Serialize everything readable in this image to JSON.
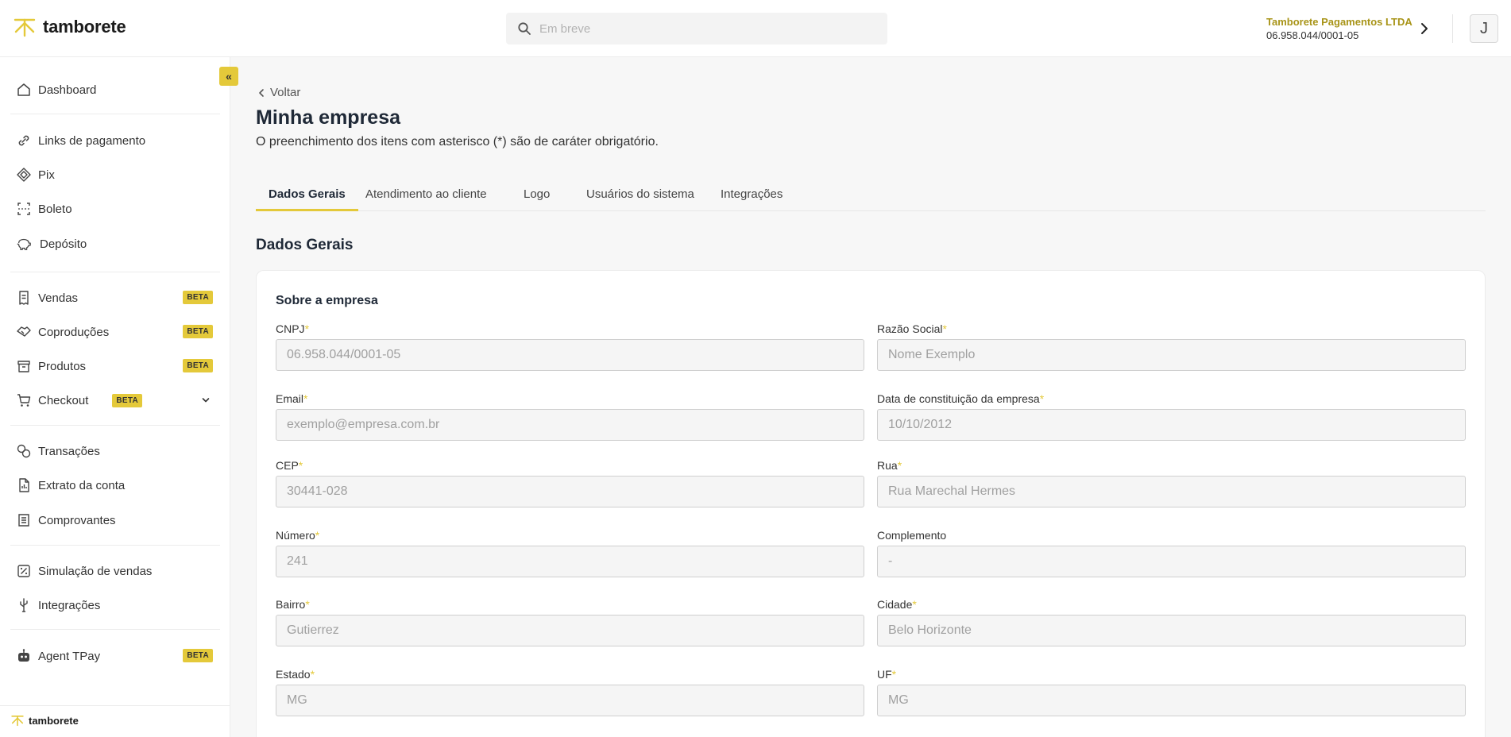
{
  "brand": {
    "name": "tamborete",
    "accent": "#e4c93a",
    "accent_dark": "#a89418"
  },
  "header": {
    "search_placeholder": "Em breve",
    "company_name": "Tamborete Pagamentos LTDA",
    "company_cnpj": "06.958.044/0001-05",
    "avatar_initial": "J"
  },
  "sidebar": {
    "collapse_label": "«",
    "items": [
      {
        "label": "Dashboard",
        "icon": "home-icon"
      },
      {
        "label": "Links de pagamento",
        "icon": "link-icon"
      },
      {
        "label": "Pix",
        "icon": "pix-icon"
      },
      {
        "label": "Boleto",
        "icon": "barcode-scan-icon"
      },
      {
        "label": "Depósito",
        "icon": "piggy-bank-icon"
      },
      {
        "label": "Vendas",
        "icon": "receipt-icon",
        "badge": "BETA"
      },
      {
        "label": "Coproduções",
        "icon": "handshake-icon",
        "badge": "BETA"
      },
      {
        "label": "Produtos",
        "icon": "box-icon",
        "badge": "BETA"
      },
      {
        "label": "Checkout",
        "icon": "cart-icon",
        "badge": "BETA"
      },
      {
        "label": "Transações",
        "icon": "transactions-icon"
      },
      {
        "label": "Extrato da conta",
        "icon": "statement-icon"
      },
      {
        "label": "Comprovantes",
        "icon": "list-icon"
      },
      {
        "label": "Simulação de vendas",
        "icon": "percent-icon"
      },
      {
        "label": "Integrações",
        "icon": "usb-icon"
      },
      {
        "label": "Agent TPay",
        "icon": "robot-icon",
        "badge": "BETA"
      }
    ],
    "footer_brand": "tamborete"
  },
  "page": {
    "back_label": "Voltar",
    "title": "Minha empresa",
    "subtitle": "O preenchimento dos itens com asterisco (*) são de caráter obrigatório.",
    "tabs": [
      "Dados Gerais",
      "Atendimento ao cliente",
      "Logo",
      "Usuários do sistema",
      "Integrações"
    ],
    "active_tab": "Dados Gerais",
    "section_title": "Dados Gerais",
    "card_title": "Sobre a empresa"
  },
  "form": {
    "cnpj": {
      "label": "CNPJ",
      "required": "*",
      "placeholder": "06.958.044/0001-05"
    },
    "razao_social": {
      "label": "Razão Social",
      "required": "*",
      "placeholder": "Nome Exemplo"
    },
    "email": {
      "label": "Email",
      "required": "*",
      "placeholder": "exemplo@empresa.com.br"
    },
    "data_constituicao": {
      "label": "Data de constituição da empresa",
      "required": "*",
      "placeholder": "10/10/2012"
    },
    "cep": {
      "label": "CEP",
      "required": "*",
      "placeholder": "30441-028"
    },
    "rua": {
      "label": "Rua",
      "required": "*",
      "placeholder": "Rua Marechal Hermes"
    },
    "numero": {
      "label": "Número",
      "required": "*",
      "placeholder": "241"
    },
    "complemento": {
      "label": "Complemento",
      "required": "",
      "placeholder": "-"
    },
    "bairro": {
      "label": "Bairro",
      "required": "*",
      "placeholder": "Gutierrez"
    },
    "cidade": {
      "label": "Cidade",
      "required": "*",
      "placeholder": "Belo Horizonte"
    },
    "estado": {
      "label": "Estado",
      "required": "*",
      "placeholder": "MG"
    },
    "uf": {
      "label": "UF",
      "required": "*",
      "placeholder": "MG"
    }
  }
}
